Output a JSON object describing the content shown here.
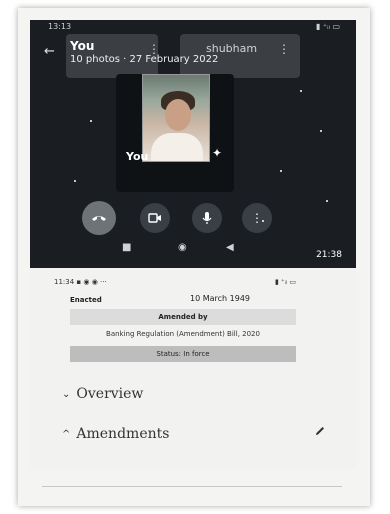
{
  "top_screen": {
    "status_time": "13:13",
    "status_right": "▮ ⁺ᵢₗ ▭",
    "back_icon": "←",
    "title": "You",
    "subtitle": "10 photos · 27 February 2022",
    "other_user": "shubham",
    "more_icon": "⋮",
    "video_label": "You",
    "clock": "21:38"
  },
  "screen2": {
    "status_left": "11:34 ▪ ◉ ◉ ···",
    "status_right": "▮ ⁺ᵢₗ ▭",
    "enacted_label": "Enacted",
    "enacted_value": "10 March 1949",
    "amended_by_label": "Amended by",
    "amended_bill": "Banking Regulation (Amendment) Bill, 2020",
    "status_text": "Status: In force",
    "overview_label": "Overview",
    "amendments_label": "Amendments",
    "chevron_down": "⌄",
    "chevron_up": "^"
  }
}
